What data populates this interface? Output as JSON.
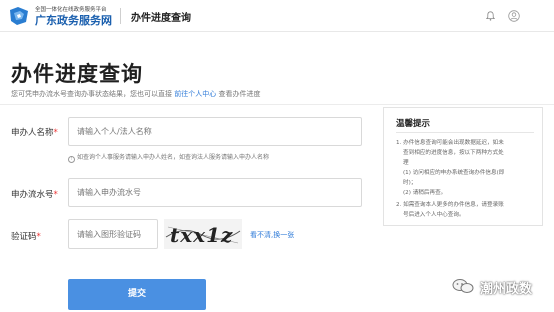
{
  "header": {
    "brand_sub": "全国一体化在线政务服务平台",
    "brand_main": "广东政务服务网",
    "section_title": "办件进度查询",
    "brand_color": "#1a5fae"
  },
  "page": {
    "title": "办件进度查询",
    "subtitle_prefix": "您可凭申办流水号查询办事状态结果，您也可以直接",
    "subtitle_link": "前往个人中心",
    "subtitle_suffix": "查看办件进度"
  },
  "form": {
    "applicant": {
      "label": "申办人名称",
      "required_mark": "*",
      "placeholder": "请输入个人/法人名称",
      "hint": "如查询个人事服务请输入申办人姓名，如查询法人服务请输入申办人名称"
    },
    "serial": {
      "label": "申办流水号",
      "required_mark": "*",
      "placeholder": "请输入申办流水号"
    },
    "captcha": {
      "label": "验证码",
      "required_mark": "*",
      "placeholder": "请输入图形验证码",
      "image_text": "txx1z",
      "refresh_label": "看不清,换一张"
    },
    "submit_label": "提交"
  },
  "tips": {
    "title": "温馨提示",
    "lines": [
      "1. 办件信息查询可能会出现数据延迟，如未",
      "查到相应的进度信息，按以下两种方式处",
      "理",
      "(1) 访问相应的申办系统查询办件信息(即",
      "时)；",
      "(2) 请稍后再查。",
      "2. 如需查询本人更多的办件信息，请登录账",
      "号后进入个人中心查询。"
    ]
  },
  "watermark": {
    "text": "潮州政数"
  },
  "colors": {
    "accent": "#4a90e2",
    "link": "#2f7bd8",
    "required": "#e33333"
  }
}
